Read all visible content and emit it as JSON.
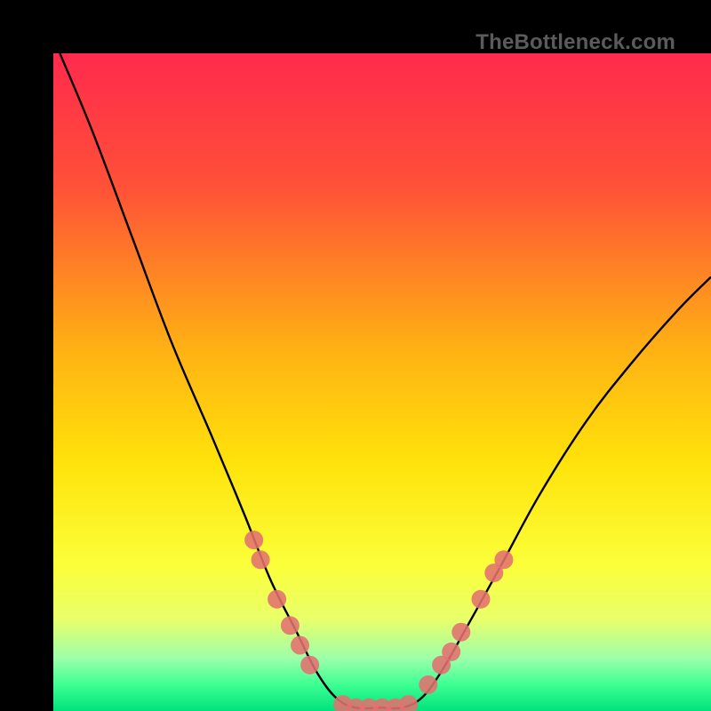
{
  "watermark": "TheBottleneck.com",
  "chart_data": {
    "type": "line",
    "title": "",
    "xlabel": "",
    "ylabel": "",
    "xlim": [
      0,
      100
    ],
    "ylim": [
      0,
      100
    ],
    "background_gradient": {
      "stops": [
        {
          "offset": 0,
          "color": "#ff2a4d"
        },
        {
          "offset": 20,
          "color": "#ff5038"
        },
        {
          "offset": 45,
          "color": "#ffb114"
        },
        {
          "offset": 62,
          "color": "#ffe20a"
        },
        {
          "offset": 78,
          "color": "#fbff3a"
        },
        {
          "offset": 86,
          "color": "#e9ff6a"
        },
        {
          "offset": 92,
          "color": "#9cffaa"
        },
        {
          "offset": 96,
          "color": "#3dff93"
        },
        {
          "offset": 100,
          "color": "#00e27b"
        }
      ]
    },
    "series": [
      {
        "name": "bottleneck-curve",
        "type": "line",
        "points": [
          {
            "x": 1,
            "y": 100
          },
          {
            "x": 6,
            "y": 88
          },
          {
            "x": 12,
            "y": 72
          },
          {
            "x": 18,
            "y": 56
          },
          {
            "x": 24,
            "y": 42
          },
          {
            "x": 29,
            "y": 30
          },
          {
            "x": 33,
            "y": 20
          },
          {
            "x": 37,
            "y": 12
          },
          {
            "x": 40,
            "y": 6
          },
          {
            "x": 43,
            "y": 2
          },
          {
            "x": 46,
            "y": 0.5
          },
          {
            "x": 50,
            "y": 0.5
          },
          {
            "x": 53,
            "y": 0.5
          },
          {
            "x": 56,
            "y": 2
          },
          {
            "x": 59,
            "y": 6
          },
          {
            "x": 63,
            "y": 13
          },
          {
            "x": 68,
            "y": 22
          },
          {
            "x": 74,
            "y": 33
          },
          {
            "x": 81,
            "y": 44
          },
          {
            "x": 88,
            "y": 53
          },
          {
            "x": 95,
            "y": 61
          },
          {
            "x": 100,
            "y": 66
          }
        ]
      },
      {
        "name": "markers",
        "type": "scatter",
        "color": "#e2716f",
        "points": [
          {
            "x": 30.5,
            "y": 26
          },
          {
            "x": 31.5,
            "y": 23
          },
          {
            "x": 34,
            "y": 17
          },
          {
            "x": 36,
            "y": 13
          },
          {
            "x": 37.5,
            "y": 10
          },
          {
            "x": 39,
            "y": 7
          },
          {
            "x": 44,
            "y": 1
          },
          {
            "x": 46,
            "y": 0.5
          },
          {
            "x": 48,
            "y": 0.5
          },
          {
            "x": 50,
            "y": 0.5
          },
          {
            "x": 52,
            "y": 0.5
          },
          {
            "x": 54,
            "y": 1
          },
          {
            "x": 57,
            "y": 4
          },
          {
            "x": 59,
            "y": 7
          },
          {
            "x": 60.5,
            "y": 9
          },
          {
            "x": 62,
            "y": 12
          },
          {
            "x": 65,
            "y": 17
          },
          {
            "x": 67,
            "y": 21
          },
          {
            "x": 68.5,
            "y": 23
          }
        ]
      }
    ]
  }
}
